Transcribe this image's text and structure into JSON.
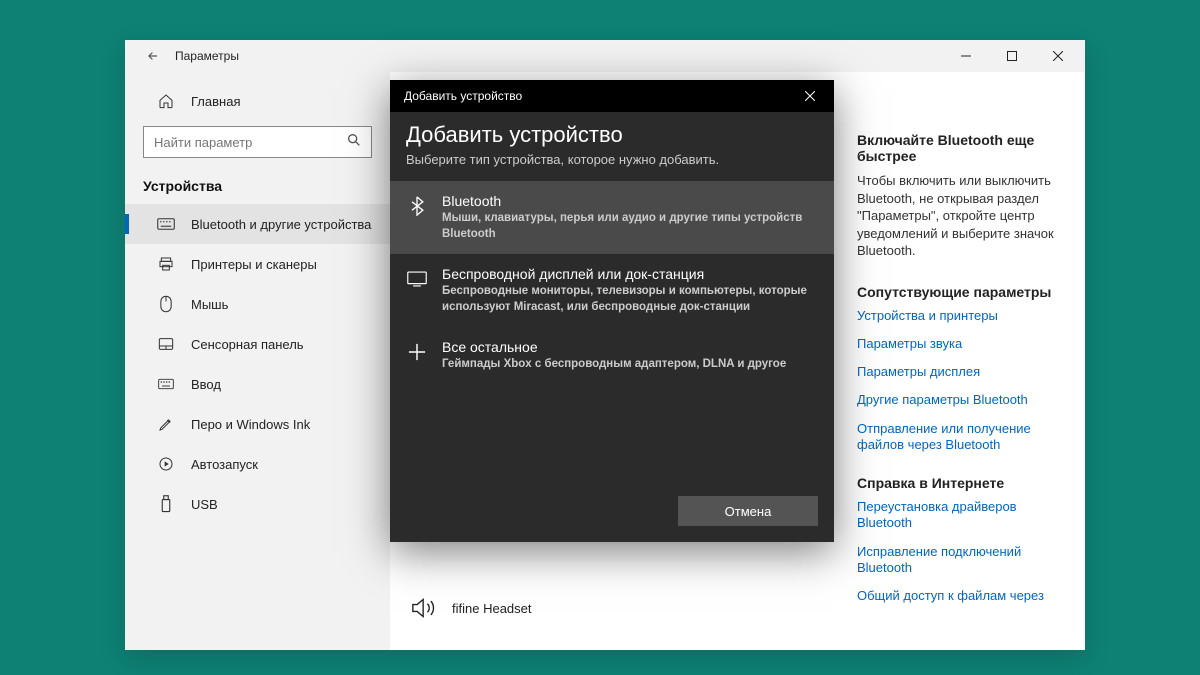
{
  "window": {
    "title": "Параметры"
  },
  "sidebar": {
    "home": "Главная",
    "search_placeholder": "Найти параметр",
    "section": "Устройства",
    "items": [
      {
        "label": "Bluetooth и другие устройства",
        "active": true
      },
      {
        "label": "Принтеры и сканеры"
      },
      {
        "label": "Мышь"
      },
      {
        "label": "Сенсорная панель"
      },
      {
        "label": "Ввод"
      },
      {
        "label": "Перо и Windows Ink"
      },
      {
        "label": "Автозапуск"
      },
      {
        "label": "USB"
      }
    ]
  },
  "content": {
    "device_name": "fifine Headset"
  },
  "aside": {
    "tip_title": "Включайте Bluetooth еще быстрее",
    "tip_text": "Чтобы включить или выключить Bluetooth, не открывая раздел \"Параметры\", откройте центр уведомлений и выберите значок Bluetooth.",
    "related_title": "Сопутствующие параметры",
    "related_links": [
      "Устройства и принтеры",
      "Параметры звука",
      "Параметры дисплея",
      "Другие параметры Bluetooth",
      "Отправление или получение файлов через Bluetooth"
    ],
    "help_title": "Справка в Интернете",
    "help_links": [
      "Переустановка драйверов Bluetooth",
      "Исправление подключений Bluetooth",
      "Общий доступ к файлам через"
    ]
  },
  "dialog": {
    "titlebar": "Добавить устройство",
    "heading": "Добавить устройство",
    "subtitle": "Выберите тип устройства, которое нужно добавить.",
    "options": [
      {
        "title": "Bluetooth",
        "desc": "Мыши, клавиатуры, перья или аудио и другие типы устройств Bluetooth"
      },
      {
        "title": "Беспроводной дисплей или док-станция",
        "desc": "Беспроводные мониторы, телевизоры и компьютеры, которые используют Miracast, или беспроводные док-станции"
      },
      {
        "title": "Все остальное",
        "desc": "Геймпады Xbox с беспроводным адаптером, DLNA и другое"
      }
    ],
    "cancel": "Отмена"
  }
}
